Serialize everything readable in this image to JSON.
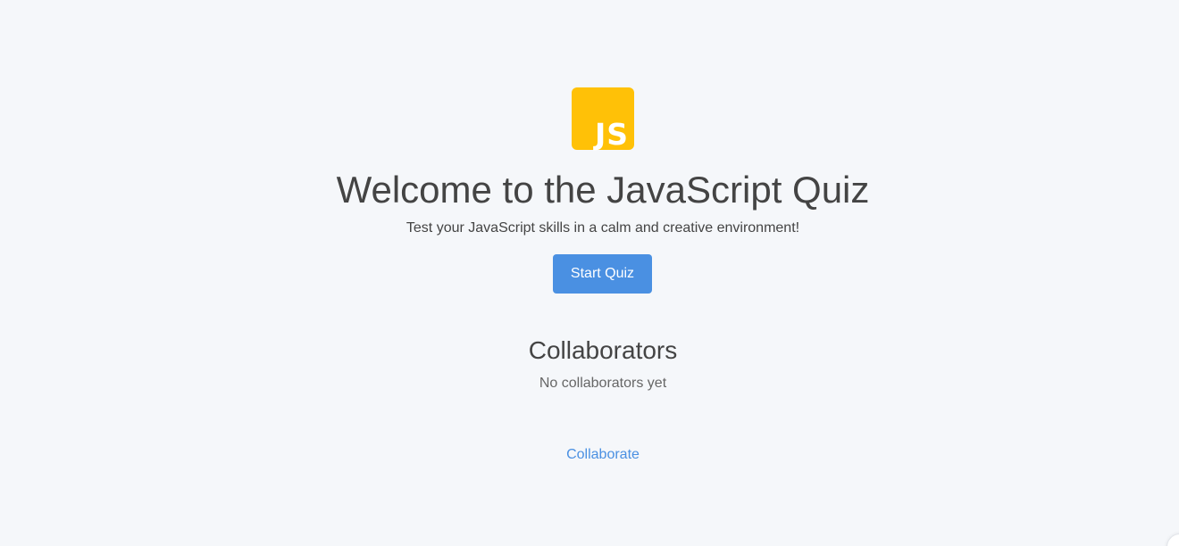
{
  "logo": {
    "text": "JS",
    "color": "#ffc107"
  },
  "hero": {
    "title": "Welcome to the JavaScript Quiz",
    "subtitle": "Test your JavaScript skills in a calm and creative environment!",
    "start_button_label": "Start Quiz"
  },
  "collaborators": {
    "heading": "Collaborators",
    "empty_text": "No collaborators yet",
    "link_label": "Collaborate"
  },
  "colors": {
    "background": "#f5f7fa",
    "accent": "#4a90e2",
    "text": "#444444"
  }
}
